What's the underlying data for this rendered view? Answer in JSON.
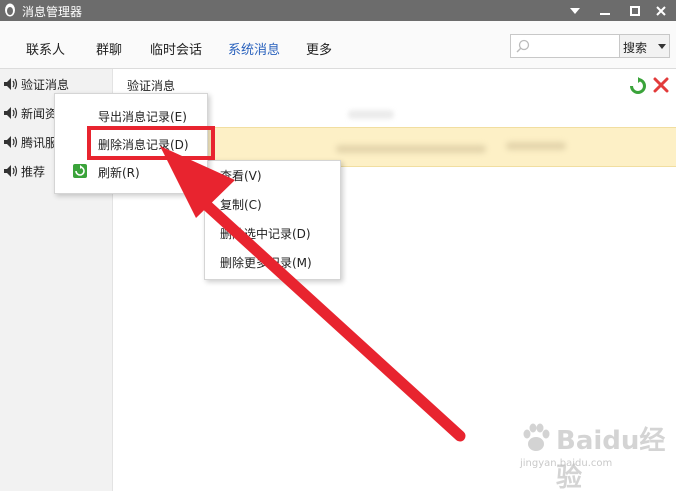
{
  "window": {
    "title": "消息管理器"
  },
  "nav": {
    "tabs": [
      {
        "label": "联系人"
      },
      {
        "label": "群聊"
      },
      {
        "label": "临时会话"
      },
      {
        "label": "系统消息"
      },
      {
        "label": "更多"
      }
    ],
    "active_tab": "系统消息",
    "search": {
      "value": "",
      "placeholder": "",
      "button_label": "搜索"
    }
  },
  "sidebar": {
    "items": [
      {
        "label": "验证消息"
      },
      {
        "label": "新闻资讯"
      },
      {
        "label": "腾讯服务"
      },
      {
        "label": "推荐"
      }
    ]
  },
  "content": {
    "title": "验证消息"
  },
  "menu_left": {
    "items": [
      {
        "label": "导出消息记录(E)"
      },
      {
        "label": "删除消息记录(D)"
      },
      {
        "label": "刷新(R)"
      }
    ]
  },
  "menu_right": {
    "items": [
      {
        "label": "查看(V)"
      },
      {
        "label": "复制(C)"
      },
      {
        "label": "删除选中记录(D)"
      },
      {
        "label": "删除更多记录(M)"
      }
    ]
  },
  "watermark": {
    "brand": "Baidu经验",
    "url": "jingyan.baidu.com"
  },
  "colors": {
    "title_bar": "#6c6c6c",
    "active_tab": "#2a62bd",
    "highlight": "#fdf0c6",
    "annotation_red": "#e8242f",
    "refresh_green": "#3aa33a",
    "delete_red": "#e23b3b"
  }
}
